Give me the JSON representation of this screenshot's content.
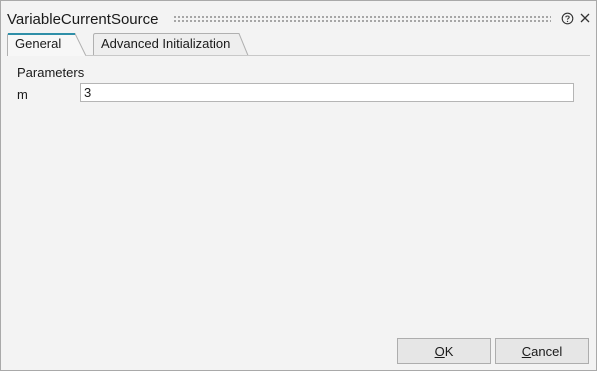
{
  "dialog": {
    "title": "VariableCurrentSource",
    "help_icon": "question-circle-icon",
    "close_icon": "close-x-icon"
  },
  "tabs": [
    {
      "label": "General",
      "active": true
    },
    {
      "label": "Advanced Initialization",
      "active": false
    }
  ],
  "parameters": {
    "section_label": "Parameters",
    "rows": [
      {
        "name": "m",
        "value": "3"
      }
    ]
  },
  "buttons": {
    "ok": {
      "mnemonic": "O",
      "rest": "K"
    },
    "cancel": {
      "mnemonic": "C",
      "rest": "ancel"
    }
  },
  "colors": {
    "dialog_background": "#f3f3f3",
    "active_tab_accent": "#2f8fa8",
    "border": "#a9a9a9"
  }
}
